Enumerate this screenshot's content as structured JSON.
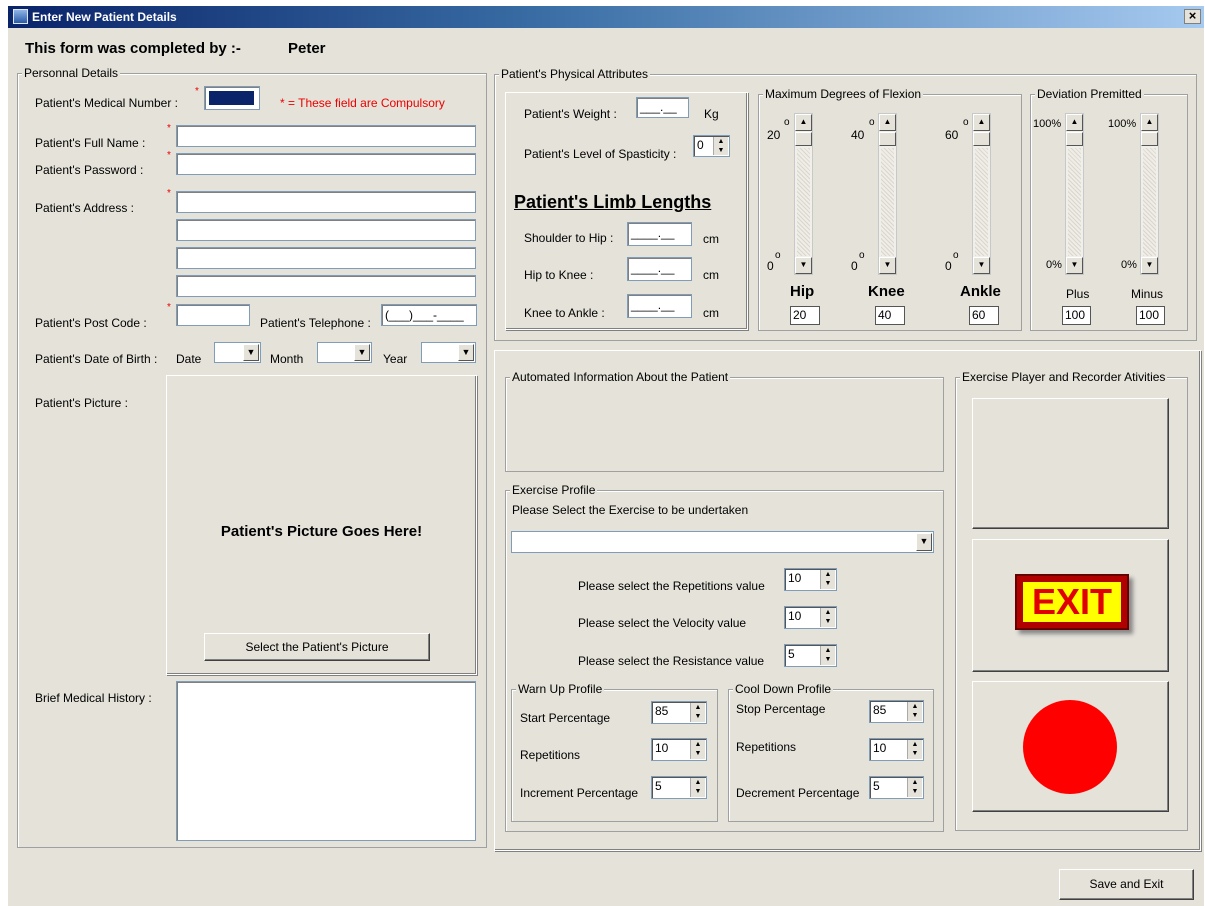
{
  "window": {
    "title": "Enter New Patient Details",
    "close_label": "×"
  },
  "header": {
    "completed_by_label": "This form was completed by :-",
    "completed_by_name": "Peter"
  },
  "personal": {
    "group_title": "Personnal Details",
    "medical_number_label": "Patient's Medical Number :",
    "required_note": "* = These field are Compulsory",
    "full_name_label": "Patient's Full Name :",
    "password_label": "Patient's Password :",
    "address_label": "Patient's Address :",
    "post_code_label": "Patient's Post Code :",
    "telephone_label": "Patient's Telephone :",
    "telephone_mask": "(___)___-____",
    "dob_label": "Patient's Date of Birth :",
    "date_label": "Date",
    "month_label": "Month",
    "year_label": "Year",
    "picture_label": "Patient's Picture :",
    "picture_placeholder": "Patient's Picture Goes Here!",
    "select_picture_button": "Select the Patient's Picture",
    "history_label": "Brief Medical History :"
  },
  "physical": {
    "group_title": "Patient's Physical Attributes",
    "weight_label": "Patient's Weight :",
    "weight_mask": "___.__",
    "weight_unit": "Kg",
    "spasticity_label": "Patient's Level of Spasticity :",
    "spasticity_value": "0",
    "limb_title": "Patient's Limb Lengths",
    "shoulder_hip_label": "Shoulder to Hip :",
    "hip_knee_label": "Hip to Knee :",
    "knee_ankle_label": "Knee to Ankle :",
    "length_mask": "____.__",
    "length_unit": "cm"
  },
  "flexion": {
    "group_title": "Maximum Degrees of Flexion",
    "degree_sign": "o",
    "zero": "0",
    "joints": [
      {
        "name": "Hip",
        "max": "20",
        "value": "20"
      },
      {
        "name": "Knee",
        "max": "40",
        "value": "40"
      },
      {
        "name": "Ankle",
        "max": "60",
        "value": "60"
      }
    ]
  },
  "deviation": {
    "group_title": "Deviation Premitted",
    "items": [
      {
        "name": "Plus",
        "max": "100%",
        "min": "0%",
        "value": "100"
      },
      {
        "name": "Minus",
        "max": "100%",
        "min": "0%",
        "value": "100"
      }
    ]
  },
  "automated": {
    "group_title": "Automated Information About the Patient"
  },
  "exercise": {
    "group_title": "Exercise Profile",
    "prompt": "Please Select the Exercise to be undertaken",
    "repetitions_label": "Please select the Repetitions value",
    "repetitions_value": "10",
    "velocity_label": "Please select the Velocity value",
    "velocity_value": "10",
    "resistance_label": "Please select the Resistance value",
    "resistance_value": "5",
    "warmup": {
      "group_title": "Warn Up Profile",
      "start_label": "Start Percentage",
      "start_value": "85",
      "reps_label": "Repetitions",
      "reps_value": "10",
      "inc_label": "Increment Percentage",
      "inc_value": "5"
    },
    "cooldown": {
      "group_title": "Cool Down Profile",
      "stop_label": "Stop Percentage",
      "stop_value": "85",
      "reps_label": "Repetitions",
      "reps_value": "10",
      "dec_label": "Decrement Percentage",
      "dec_value": "5"
    }
  },
  "player": {
    "group_title": "Exercise Player and Recorder Ativities",
    "exit_label": "EXIT"
  },
  "footer": {
    "save_exit_button": "Save and Exit"
  },
  "colors": {
    "title_start": "#0a246a",
    "required": "#e00000",
    "record": "#ff0000",
    "exit_bg": "#ffff00",
    "exit_text": "#e00000"
  }
}
